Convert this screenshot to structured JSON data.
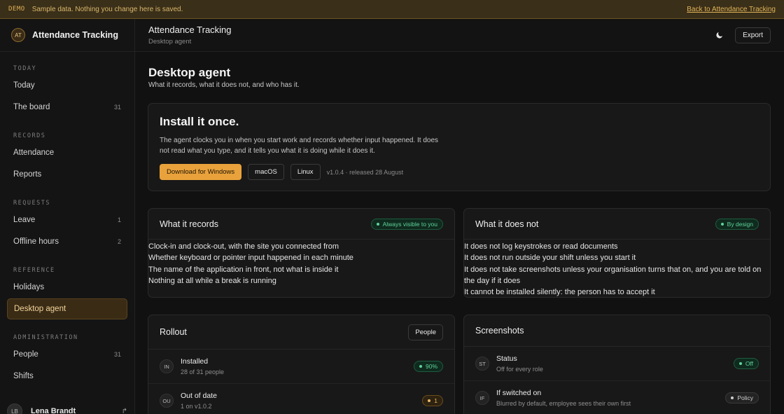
{
  "banner": {
    "tag": "DEMO",
    "message": "Sample data. Nothing you change here is saved.",
    "link": "Back to Attendance Tracking"
  },
  "sidebar": {
    "brand_initials": "AT",
    "brand_name": "Attendance Tracking",
    "sections": [
      {
        "heading": "TODAY",
        "items": [
          {
            "label": "Today",
            "count": ""
          },
          {
            "label": "The board",
            "count": "31"
          }
        ]
      },
      {
        "heading": "RECORDS",
        "items": [
          {
            "label": "Attendance",
            "count": ""
          },
          {
            "label": "Reports",
            "count": ""
          }
        ]
      },
      {
        "heading": "REQUESTS",
        "items": [
          {
            "label": "Leave",
            "count": "1"
          },
          {
            "label": "Offline hours",
            "count": "2"
          }
        ]
      },
      {
        "heading": "REFERENCE",
        "items": [
          {
            "label": "Holidays",
            "count": ""
          },
          {
            "label": "Desktop agent",
            "count": "",
            "active": true
          }
        ]
      },
      {
        "heading": "ADMINISTRATION",
        "items": [
          {
            "label": "People",
            "count": "31"
          },
          {
            "label": "Shifts",
            "count": ""
          }
        ]
      }
    ],
    "user": {
      "initials": "LB",
      "name": "Lena Brandt"
    }
  },
  "header": {
    "title": "Attendance Tracking",
    "subtitle": "Desktop agent",
    "export_label": "Export"
  },
  "page": {
    "title": "Desktop agent",
    "subtitle": "What it records, what it does not, and who has it."
  },
  "install": {
    "title": "Install it once.",
    "text": "The agent clocks you in when you start work and records whether input happened. It does not read what you type, and it tells you what it is doing while it does it.",
    "download_windows": "Download for Windows",
    "macos": "macOS",
    "linux": "Linux",
    "release": "v1.0.4 · released 28 August"
  },
  "records": {
    "title": "What it records",
    "badge": "Always visible to you",
    "lines": [
      "Clock-in and clock-out, with the site you connected from",
      "Whether keyboard or pointer input happened in each minute",
      "The name of the application in front, not what is inside it",
      "Nothing at all while a break is running"
    ]
  },
  "does_not": {
    "title": "What it does not",
    "badge": "By design",
    "lines": [
      "It does not log keystrokes or read documents",
      "It does not run outside your shift unless you start it",
      "It does not take screenshots unless your organisation turns that on, and you are told on the day if it does",
      "It cannot be installed silently: the person has to accept it"
    ]
  },
  "rollout": {
    "title": "Rollout",
    "button": "People",
    "rows": [
      {
        "initials": "IN",
        "title": "Installed",
        "sub": "28 of 31 people",
        "badge": "90%",
        "tone": "green"
      },
      {
        "initials": "OU",
        "title": "Out of date",
        "sub": "1 on v1.0.2",
        "badge": "1",
        "tone": "amber"
      }
    ]
  },
  "screenshots": {
    "title": "Screenshots",
    "rows": [
      {
        "initials": "ST",
        "title": "Status",
        "sub": "Off for every role",
        "badge": "Off",
        "tone": "green"
      },
      {
        "initials": "IF",
        "title": "If switched on",
        "sub": "Blurred by default, employee sees their own first",
        "badge": "Policy",
        "tone": "grey"
      }
    ]
  }
}
